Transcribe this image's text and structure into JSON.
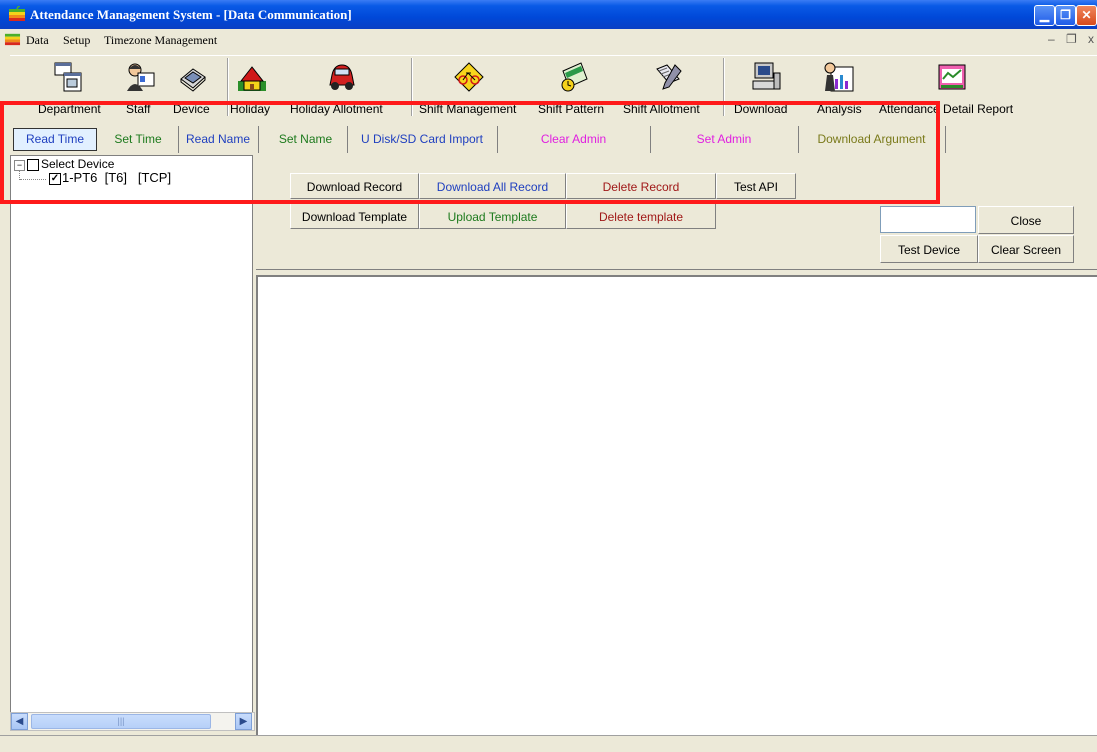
{
  "window": {
    "title": "Attendance Management System - [Data Communication]"
  },
  "menu": {
    "items": [
      "Data",
      "Setup",
      "Timezone Management"
    ]
  },
  "toolbar": {
    "items": [
      {
        "label": "Department",
        "icon": "department-icon"
      },
      {
        "label": "Staff",
        "icon": "staff-icon"
      },
      {
        "label": "Device",
        "icon": "device-icon"
      },
      {
        "label": "Holiday",
        "icon": "holiday-icon"
      },
      {
        "label": "Holiday Allotment",
        "icon": "car-icon"
      },
      {
        "label": "Shift Management",
        "icon": "bicycle-icon"
      },
      {
        "label": "Shift Pattern",
        "icon": "calendar-icon"
      },
      {
        "label": "Shift Allotment",
        "icon": "pen-icon"
      },
      {
        "label": "Download",
        "icon": "computer-icon"
      },
      {
        "label": "Analysis",
        "icon": "analysis-icon"
      },
      {
        "label": "Attendance Detail Report",
        "icon": "report-icon"
      }
    ]
  },
  "tabs": [
    {
      "label": "Read Time",
      "color": "#1f3fbf"
    },
    {
      "label": "Set Time",
      "color": "#1d7a1d"
    },
    {
      "label": "Read Name",
      "color": "#1f3fbf"
    },
    {
      "label": "Set Name",
      "color": "#1d7a1d"
    },
    {
      "label": "U Disk/SD Card Import",
      "color": "#1f3fbf"
    },
    {
      "label": "Clear Admin",
      "color": "#e020e0"
    },
    {
      "label": "Set Admin",
      "color": "#e020e0"
    },
    {
      "label": "Download Argument",
      "color": "#7a7a1a"
    }
  ],
  "tree": {
    "root_label": "Select Device",
    "device_label": "1-PT6  [T6]   [TCP]"
  },
  "buttons": {
    "download_record": "Download Record",
    "download_all_record": "Download All Record",
    "delete_record": "Delete Record",
    "test_api": "Test API",
    "download_template": "Download Template",
    "upload_template": "Upload Template",
    "delete_template": "Delete template",
    "close": "Close",
    "test_device": "Test Device",
    "clear_screen": "Clear Screen"
  },
  "colors": {
    "blue": "#1f3fbf",
    "green": "#1d7a1d",
    "darkred": "#a01818",
    "highlight": "#ff1a1a"
  }
}
